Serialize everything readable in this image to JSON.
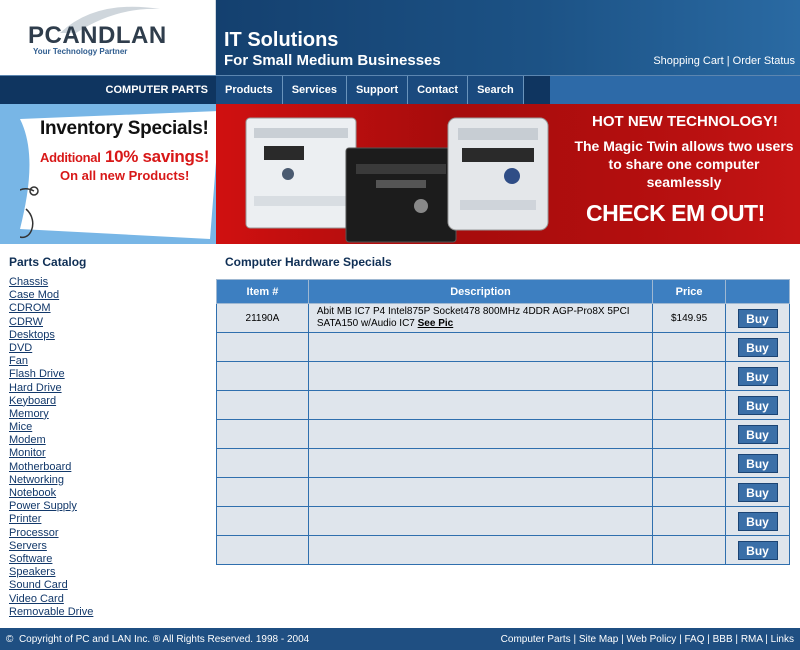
{
  "logo": {
    "text_1": "PC",
    "text_2": "AND",
    "text_3": "LAN",
    "tagline": "Your Technology Partner"
  },
  "header": {
    "line1": "IT Solutions",
    "line2": "For Small Medium Businesses",
    "links": [
      "Shopping Cart",
      "Order Status"
    ],
    "separator": " | "
  },
  "nav": {
    "label": "COMPUTER PARTS",
    "tabs": [
      "Products",
      "Services",
      "Support",
      "Contact",
      "Search"
    ]
  },
  "promo_left": {
    "title": "Inventory Specials!",
    "line2_prefix": "Additional",
    "line2_highlight": "10% savings!",
    "line3": "On all new Products!"
  },
  "promo_right": {
    "title": "HOT NEW TECHNOLOGY!",
    "description": "The Magic Twin allows two users to share one computer seamlessly",
    "cta": "CHECK EM OUT!"
  },
  "sidebar": {
    "title": "Parts Catalog",
    "items": [
      "Chassis",
      "Case Mod",
      "CDROM",
      "CDRW",
      "Desktops",
      "DVD",
      "Fan",
      "Flash Drive",
      "Hard Drive",
      "Keyboard",
      "Memory",
      "Mice",
      "Modem",
      "Monitor",
      "Motherboard",
      "Networking",
      "Notebook",
      "Power Supply",
      "Printer",
      "Processor",
      "Servers",
      "Software",
      "Speakers",
      "Sound Card",
      "Video Card",
      "Removable Drive"
    ]
  },
  "main": {
    "title": "Computer Hardware Specials",
    "columns": [
      "Item #",
      "Description",
      "Price",
      ""
    ],
    "rows": [
      {
        "item": "21190A",
        "description": "Abit MB IC7 P4 Intel875P Socket478 800MHz 4DDR AGP-Pro8X 5PCI SATA150 w/Audio  IC7",
        "link": "See Pic",
        "price": "$149.95",
        "buy": "Buy"
      },
      {
        "item": "",
        "description": "",
        "link": "",
        "price": "",
        "buy": "Buy"
      },
      {
        "item": "",
        "description": "",
        "link": "",
        "price": "",
        "buy": "Buy"
      },
      {
        "item": "",
        "description": "",
        "link": "",
        "price": "",
        "buy": "Buy"
      },
      {
        "item": "",
        "description": "",
        "link": "",
        "price": "",
        "buy": "Buy"
      },
      {
        "item": "",
        "description": "",
        "link": "",
        "price": "",
        "buy": "Buy"
      },
      {
        "item": "",
        "description": "",
        "link": "",
        "price": "",
        "buy": "Buy"
      },
      {
        "item": "",
        "description": "",
        "link": "",
        "price": "",
        "buy": "Buy"
      },
      {
        "item": "",
        "description": "",
        "link": "",
        "price": "",
        "buy": "Buy"
      }
    ]
  },
  "footer": {
    "copyright_symbol": "©",
    "copyright": "Copyright of PC and LAN Inc. ® All Rights Reserved. 1998 - 2004",
    "links": [
      "Computer Parts",
      "Site Map",
      "Web Policy",
      "FAQ",
      "BBB",
      "RMA",
      "Links"
    ],
    "separator": " | "
  },
  "colors": {
    "header_dark": "#14406f",
    "nav_dark": "#0f3560",
    "nav_tab": "#1a4a7e",
    "nav_accent": "#2d6aa8",
    "promo_left_bg": "#78b6e6",
    "promo_red": "#b20e0e",
    "table_header": "#3d7fc1",
    "table_cell": "#dfe5ec",
    "footer": "#1f4f82"
  }
}
